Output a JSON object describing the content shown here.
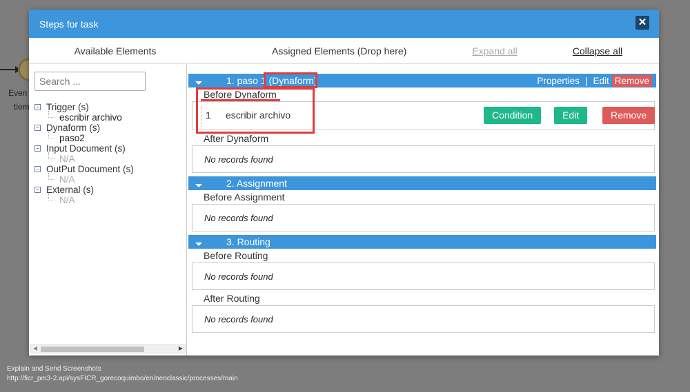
{
  "background": {
    "event_text_1": "Even",
    "event_text_2": "tiem"
  },
  "dialog": {
    "title": "Steps for task",
    "close_label": "✕"
  },
  "columns": {
    "available": "Available Elements",
    "assigned": "Assigned Elements (Drop here)",
    "expand_all": "Expand all",
    "collapse_all": "Collapse all"
  },
  "search": {
    "placeholder": "Search ..."
  },
  "tree": [
    {
      "label": "Trigger (s)",
      "children": [
        "escribir archivo"
      ],
      "na": false
    },
    {
      "label": "Dynaform (s)",
      "children": [
        "paso2"
      ],
      "na": false
    },
    {
      "label": "Input Document (s)",
      "children": [
        "N/A"
      ],
      "na": true
    },
    {
      "label": "OutPut Document (s)",
      "children": [
        "N/A"
      ],
      "na": true
    },
    {
      "label": "External (s)",
      "children": [
        "N/A"
      ],
      "na": true
    }
  ],
  "steps": [
    {
      "title": "1. paso 1 (Dynaform)",
      "actions": {
        "properties": "Properties",
        "edit": "Edit",
        "remove": "Remove"
      },
      "before_label": "Before Dynaform",
      "before_row": {
        "num": "1",
        "name": "escribir archivo",
        "condition": "Condition",
        "edit": "Edit",
        "remove": "Remove"
      },
      "after_label": "After Dynaform",
      "after_empty": "No records found"
    },
    {
      "title": "2. Assignment",
      "before_label": "Before Assignment",
      "before_empty": "No records found"
    },
    {
      "title": "3. Routing",
      "before_label": "Before Routing",
      "before_empty": "No records found",
      "after_label": "After Routing",
      "after_empty": "No records found"
    }
  ],
  "footer": {
    "line1": "Explain and Send Screenshots",
    "line2": "http://ficr_pm3-2.api/sysFICR_gorecoquimbo/en/neoclassic/processes/main"
  },
  "colors": {
    "header_blue": "#3d95db",
    "button_green": "#1fb88a",
    "button_red": "#e05a5a",
    "annotation_red": "#e23b3b"
  }
}
